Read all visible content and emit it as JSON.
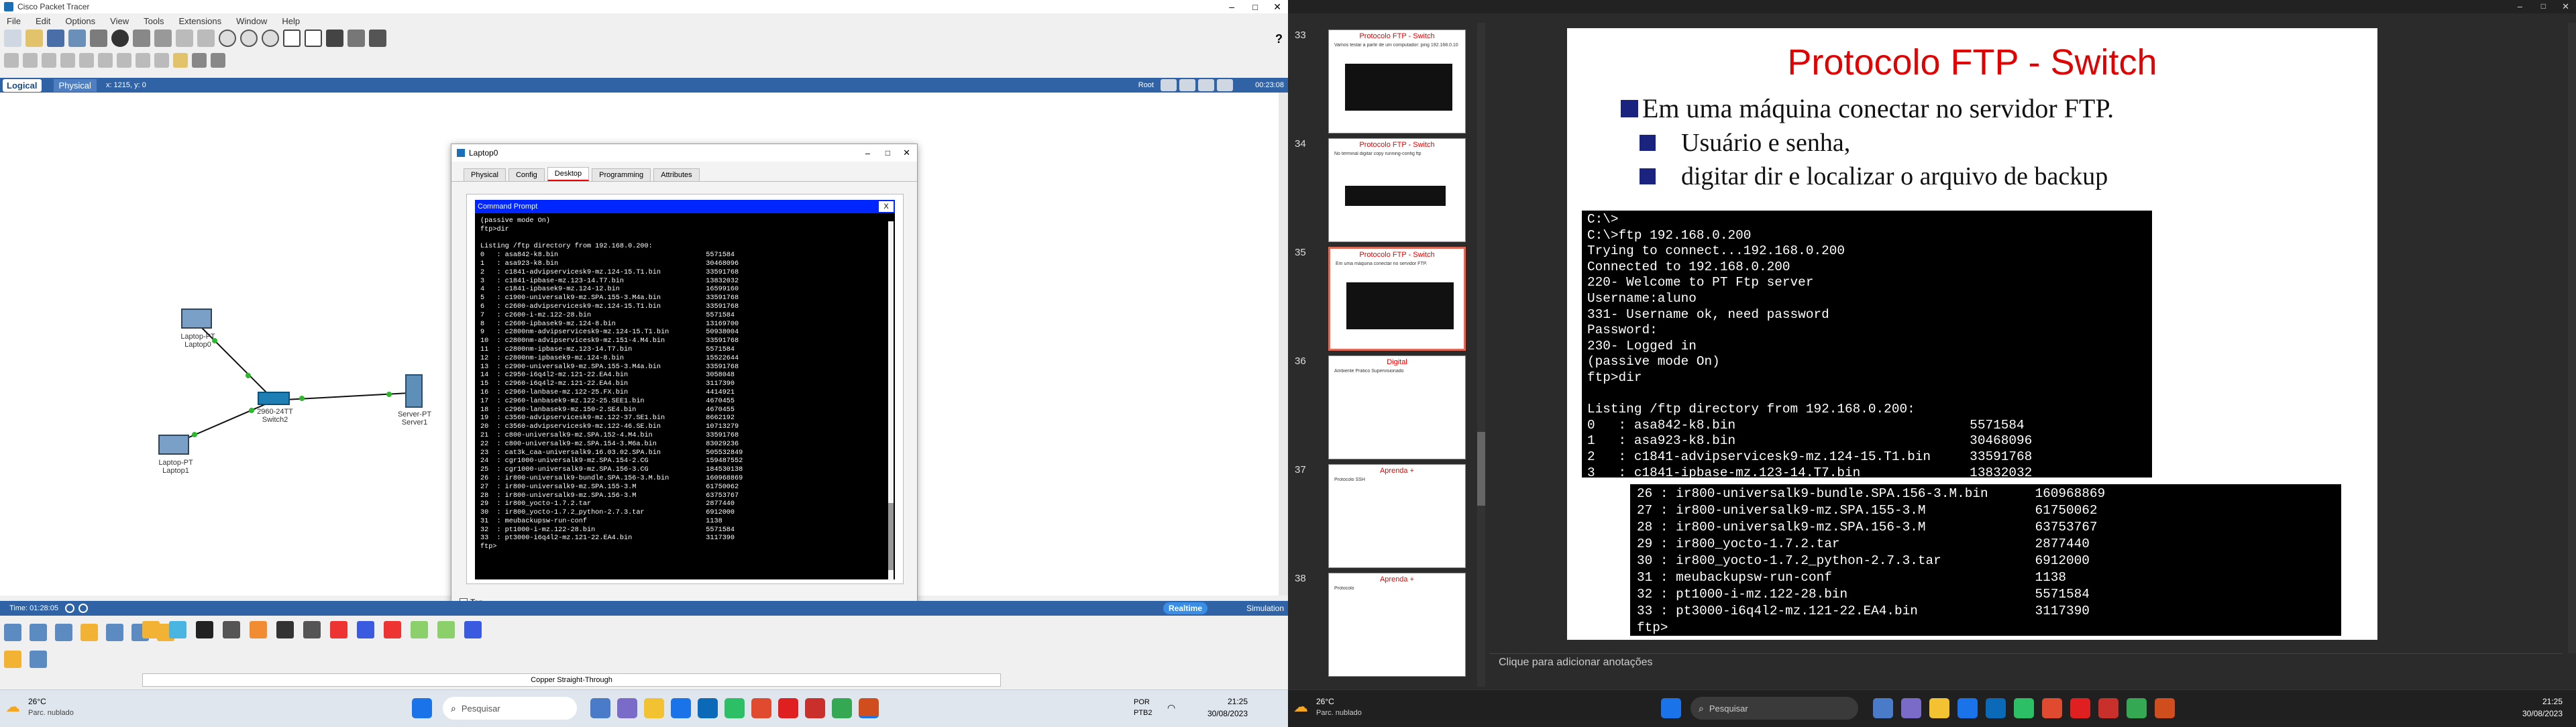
{
  "pt": {
    "title": "Cisco Packet Tracer",
    "menu": [
      "File",
      "Edit",
      "Options",
      "View",
      "Tools",
      "Extensions",
      "Window",
      "Help"
    ],
    "logical": "Logical",
    "physical": "Physical",
    "coords": "x: 1215, y: 0",
    "root": "Root",
    "clock": "00:23:08",
    "time": "Time: 01:28:05",
    "realtime": "Realtime",
    "simulation": "Simulation",
    "cable": "Copper Straight-Through",
    "devices": [
      {
        "name": "Laptop-PT",
        "sub": "Laptop0"
      },
      {
        "name": "2960-24TT",
        "sub": "Switch2"
      },
      {
        "name": "Server-PT",
        "sub": "Server1"
      },
      {
        "name": "Laptop-PT",
        "sub": "Laptop1"
      }
    ]
  },
  "laptop_window": {
    "title": "Laptop0",
    "tabs": [
      "Physical",
      "Config",
      "Desktop",
      "Programming",
      "Attributes"
    ],
    "cmd_title": "Command Prompt",
    "close": "X",
    "top_check": "Top",
    "lines": [
      "(passive mode On)",
      "ftp>dir",
      "",
      "Listing /ftp directory from 192.168.0.200:",
      "0   : asa842-k8.bin                                    5571584",
      "1   : asa923-k8.bin                                    30468096",
      "2   : c1841-advipservicesk9-mz.124-15.T1.bin           33591768",
      "3   : c1841-ipbase-mz.123-14.T7.bin                    13832032",
      "4   : c1841-ipbasek9-mz.124-12.bin                     16599160",
      "5   : c1900-universalk9-mz.SPA.155-3.M4a.bin           33591768",
      "6   : c2600-advipservicesk9-mz.124-15.T1.bin           33591768",
      "7   : c2600-i-mz.122-28.bin                            5571584",
      "8   : c2600-ipbasek9-mz.124-8.bin                      13169700",
      "9   : c2800nm-advipservicesk9-mz.124-15.T1.bin         50938004",
      "10  : c2800nm-advipservicesk9-mz.151-4.M4.bin          33591768",
      "11  : c2800nm-ipbase-mz.123-14.T7.bin                  5571584",
      "12  : c2800nm-ipbasek9-mz.124-8.bin                    15522644",
      "13  : c2900-universalk9-mz.SPA.155-3.M4a.bin           33591768",
      "14  : c2950-i6q4l2-mz.121-22.EA4.bin                   3058048",
      "15  : c2960-i6q4l2-mz.121-22.EA4.bin                   3117390",
      "16  : c2960-lanbase-mz.122-25.FX.bin                   4414921",
      "17  : c2960-lanbasek9-mz.122-25.SEE1.bin               4670455",
      "18  : c2960-lanbasek9-mz.150-2.SE4.bin                 4670455",
      "19  : c3560-advipservicesk9-mz.122-37.SE1.bin          8662192",
      "20  : c3560-advipservicesk9-mz.122-46.SE.bin           10713279",
      "21  : c800-universalk9-mz.SPA.152-4.M4.bin             33591768",
      "22  : c800-universalk9-mz.SPA.154-3.M6a.bin            83029236",
      "23  : cat3k_caa-universalk9.16.03.02.SPA.bin           505532849",
      "24  : cgr1000-universalk9-mz.SPA.154-2.CG              159487552",
      "25  : cgr1000-universalk9-mz.SPA.156-3.CG              184530138",
      "26  : ir800-universalk9-bundle.SPA.156-3.M.bin         160968869",
      "27  : ir800-universalk9-mz.SPA.155-3.M                 61750062",
      "28  : ir800-universalk9-mz.SPA.156-3.M                 63753767",
      "29  : ir800_yocto-1.7.2.tar                            2877440",
      "30  : ir800_yocto-1.7.2_python-2.7.3.tar               6912000",
      "31  : meubackupsw-run-conf                             1138",
      "32  : pt1000-i-mz.122-28.bin                           5571584",
      "33  : pt3000-i6q4l2-mz.121-22.EA4.bin                  3117390",
      "ftp>"
    ]
  },
  "taskbar_left": {
    "temp": "26°C",
    "weather": "Parc. nublado",
    "search": "Pesquisar",
    "lang": "POR",
    "kb": "PTB2",
    "time": "21:25",
    "date": "30/08/2023"
  },
  "slides": {
    "thumbs": [
      {
        "n": "33",
        "title": "Protocolo FTP - Switch",
        "text": "Vamos testar a partir de um computador: ping 192.168.0.10"
      },
      {
        "n": "34",
        "title": "Protocolo FTP - Switch",
        "text": "No terminal digitar copy running-config ftp"
      },
      {
        "n": "35",
        "title": "Protocolo FTP - Switch",
        "text": "Em uma máquina conectar no servidor FTP."
      },
      {
        "n": "36",
        "title": "Digital",
        "text": "Ambiente Prático Supervisionado"
      },
      {
        "n": "37",
        "title": "Aprenda +",
        "text": "Protocolo SSH"
      },
      {
        "n": "38",
        "title": "Aprenda +",
        "text": "Protocolo"
      }
    ],
    "main": {
      "title": "Protocolo FTP - Switch",
      "bullets": [
        "Em uma máquina conectar no servidor FTP.",
        "Usuário e senha,",
        "digitar dir e localizar o arquivo de backup"
      ],
      "term1": [
        "C:\\>",
        "C:\\>ftp 192.168.0.200",
        "Trying to connect...192.168.0.200",
        "Connected to 192.168.0.200",
        "220- Welcome to PT Ftp server",
        "Username:aluno",
        "331- Username ok, need password",
        "Password:",
        "230- Logged in",
        "(passive mode On)",
        "ftp>dir",
        "",
        "Listing /ftp directory from 192.168.0.200:",
        "0   : asa842-k8.bin                              5571584",
        "1   : asa923-k8.bin                              30468096",
        "2   : c1841-advipservicesk9-mz.124-15.T1.bin     33591768",
        "3   : c1841-ipbase-mz.123-14.T7.bin              13832032"
      ],
      "term2": [
        "26 : ir800-universalk9-bundle.SPA.156-3.M.bin      160968869",
        "27 : ir800-universalk9-mz.SPA.155-3.M              61750062",
        "28 : ir800-universalk9-mz.SPA.156-3.M              63753767",
        "29 : ir800_yocto-1.7.2.tar                         2877440",
        "30 : ir800_yocto-1.7.2_python-2.7.3.tar            6912000",
        "31 : meubackupsw-run-conf                          1138",
        "32 : pt1000-i-mz.122-28.bin                        5571584",
        "33 : pt3000-i6q4l2-mz.121-22.EA4.bin               3117390",
        "ftp>"
      ],
      "notes": "Clique para adicionar anotações"
    }
  },
  "taskbar_right": {
    "temp": "26°C",
    "weather": "Parc. nublado",
    "search": "Pesquisar",
    "time": "21:25",
    "date": "30/08/2023"
  }
}
